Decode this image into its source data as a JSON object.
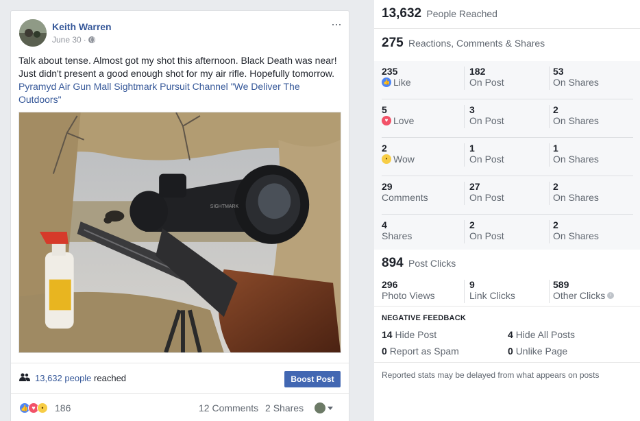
{
  "post": {
    "author": "Keith Warren",
    "date": "June 30",
    "date_sep": "·",
    "more_icon": "···",
    "text": "Talk about tense. Almost got my shot this afternoon. Black Death was near! Just didn't present a good enough shot for my air rifle. Hopefully tomorrow.",
    "tags": "Pyramyd Air Gun Mall Sightmark Pursuit Channel \"We Deliver The Outdoors\"",
    "reach_count": "13,632 people",
    "reach_suffix": "reached",
    "boost_label": "Boost Post",
    "reaction_count": "186",
    "comments": "12 Comments",
    "shares": "2 Shares",
    "scope_brand": "SIGHTMARK"
  },
  "insights": {
    "reached_value": "13,632",
    "reached_label": "People Reached",
    "engagement_value": "275",
    "engagement_label": "Reactions, Comments & Shares",
    "rows": [
      {
        "total": "235",
        "label": "Like",
        "icon": "like-icon",
        "on_post": "182",
        "on_post_label": "On Post",
        "on_shares": "53",
        "on_shares_label": "On Shares"
      },
      {
        "total": "5",
        "label": "Love",
        "icon": "love-icon",
        "on_post": "3",
        "on_post_label": "On Post",
        "on_shares": "2",
        "on_shares_label": "On Shares"
      },
      {
        "total": "2",
        "label": "Wow",
        "icon": "wow-icon",
        "on_post": "1",
        "on_post_label": "On Post",
        "on_shares": "1",
        "on_shares_label": "On Shares"
      },
      {
        "total": "29",
        "label": "Comments",
        "icon": "",
        "on_post": "27",
        "on_post_label": "On Post",
        "on_shares": "2",
        "on_shares_label": "On Shares"
      },
      {
        "total": "4",
        "label": "Shares",
        "icon": "",
        "on_post": "2",
        "on_post_label": "On Post",
        "on_shares": "2",
        "on_shares_label": "On Shares"
      }
    ],
    "clicks_value": "894",
    "clicks_label": "Post Clicks",
    "photo_views": "296",
    "photo_views_label": "Photo Views",
    "link_clicks": "9",
    "link_clicks_label": "Link Clicks",
    "other_clicks": "589",
    "other_clicks_label": "Other Clicks",
    "negative_title": "NEGATIVE FEEDBACK",
    "hide_post": "14",
    "hide_post_label": "Hide Post",
    "hide_all": "4",
    "hide_all_label": "Hide All Posts",
    "report_spam": "0",
    "report_spam_label": "Report as Spam",
    "unlike_page": "0",
    "unlike_page_label": "Unlike Page",
    "footnote": "Reported stats may be delayed from what appears on posts"
  }
}
